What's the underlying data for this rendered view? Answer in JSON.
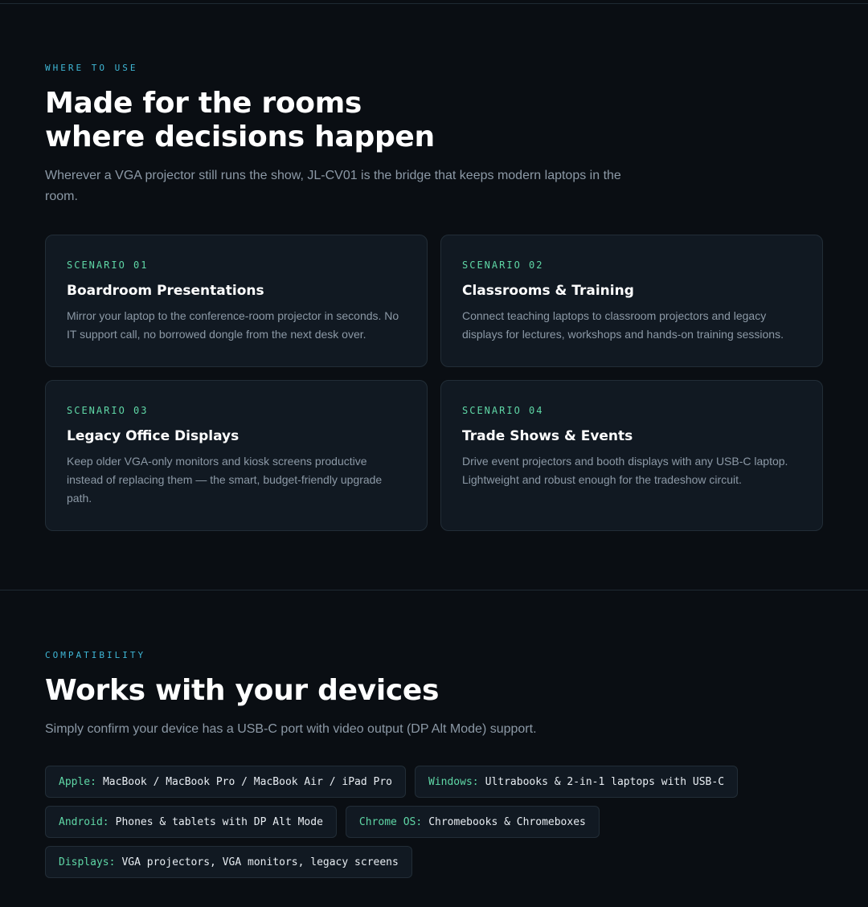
{
  "where_to_use": {
    "eyebrow": "WHERE TO USE",
    "heading_line1": "Made for the rooms",
    "heading_line2": "where decisions happen",
    "lead": "Wherever a VGA projector still runs the show, JL-CV01 is the bridge that keeps modern laptops in the room.",
    "scenarios": [
      {
        "tag": "SCENARIO 01",
        "title": "Boardroom Presentations",
        "text": "Mirror your laptop to the conference-room projector in seconds. No IT support call, no borrowed dongle from the next desk over."
      },
      {
        "tag": "SCENARIO 02",
        "title": "Classrooms & Training",
        "text": "Connect teaching laptops to classroom projectors and legacy displays for lectures, workshops and hands-on training sessions."
      },
      {
        "tag": "SCENARIO 03",
        "title": "Legacy Office Displays",
        "text": "Keep older VGA-only monitors and kiosk screens productive instead of replacing them — the smart, budget-friendly upgrade path."
      },
      {
        "tag": "SCENARIO 04",
        "title": "Trade Shows & Events",
        "text": "Drive event projectors and booth displays with any USB-C laptop. Lightweight and robust enough for the tradeshow circuit."
      }
    ]
  },
  "compatibility": {
    "eyebrow": "COMPATIBILITY",
    "heading": "Works with your devices",
    "lead": "Simply confirm your device has a USB-C port with video output (DP Alt Mode) support.",
    "devices": [
      {
        "key": "Apple:",
        "value": "MacBook / MacBook Pro / MacBook Air / iPad Pro"
      },
      {
        "key": "Windows:",
        "value": "Ultrabooks & 2-in-1 laptops with USB-C"
      },
      {
        "key": "Android:",
        "value": "Phones & tablets with DP Alt Mode"
      },
      {
        "key": "Chrome OS:",
        "value": "Chromebooks & Chromeboxes"
      },
      {
        "key": "Displays:",
        "value": "VGA projectors, VGA monitors, legacy screens"
      }
    ]
  },
  "colors": {
    "background": "#0a0e13",
    "card": "#111922",
    "eyebrow_accent": "#3fb7d6",
    "tag_accent": "#5fd7a6"
  }
}
